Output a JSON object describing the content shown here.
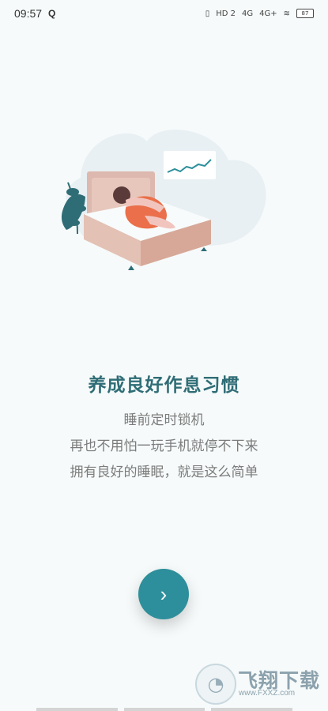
{
  "status_bar": {
    "time": "09:57",
    "q": "Q",
    "network1": "HD 2",
    "network2": "4G",
    "network3": "4G+",
    "battery": "87"
  },
  "content": {
    "title": "养成良好作息习惯",
    "lines": [
      "睡前定时锁机",
      "再也不用怕一玩手机就停不下来",
      "拥有良好的睡眠，就是这么简单"
    ]
  },
  "next_button": {
    "label": "›"
  },
  "watermark": {
    "text": "飞翔下载",
    "url": "www.FXXZ.com"
  },
  "colors": {
    "primary": "#2d8f9b",
    "title": "#2f6d76",
    "background": "#f6fafa"
  }
}
